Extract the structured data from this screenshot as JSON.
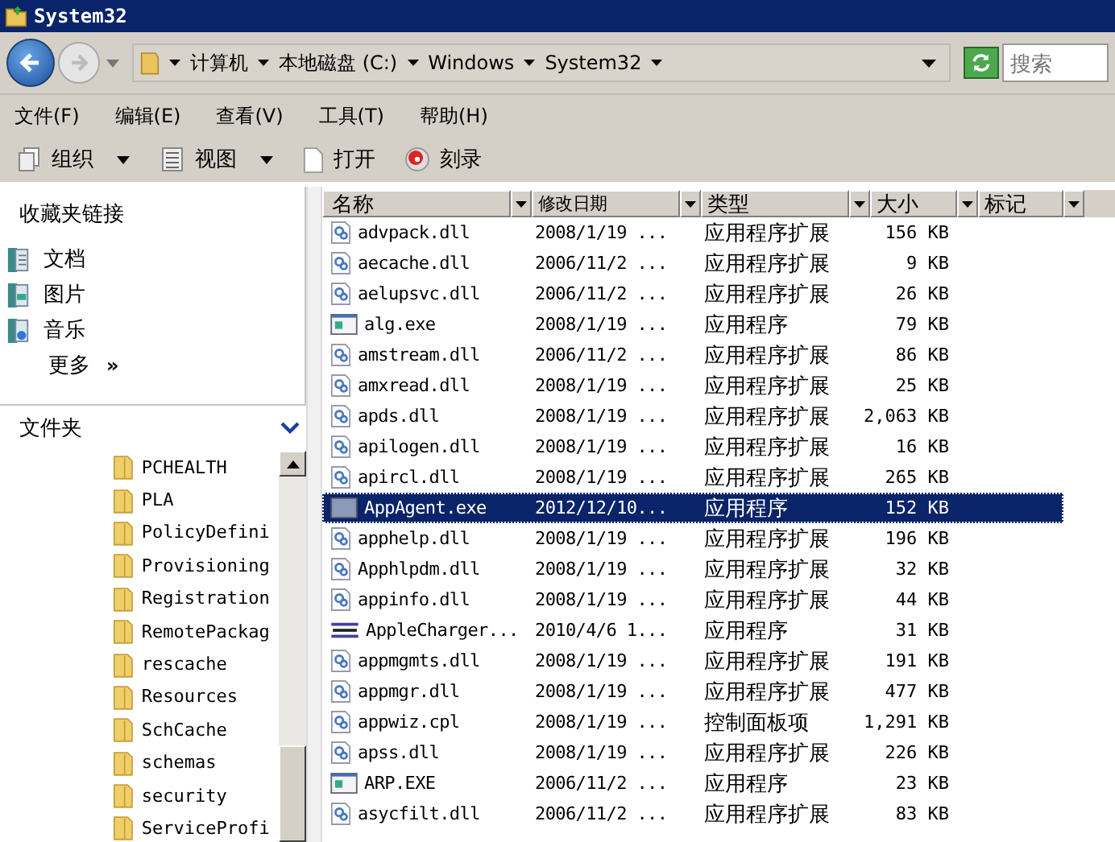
{
  "window": {
    "title": "System32"
  },
  "address": {
    "crumbs": [
      "计算机",
      "本地磁盘 (C:)",
      "Windows",
      "System32"
    ]
  },
  "search": {
    "placeholder": "搜索"
  },
  "menu": [
    "文件(F)",
    "编辑(E)",
    "查看(V)",
    "工具(T)",
    "帮助(H)"
  ],
  "toolbar": [
    {
      "kind": "organize",
      "label": "组织",
      "dropdown": true
    },
    {
      "kind": "views",
      "label": "视图",
      "dropdown": true
    },
    {
      "kind": "open",
      "label": "打开",
      "dropdown": false
    },
    {
      "kind": "burn",
      "label": "刻录",
      "dropdown": false
    }
  ],
  "favorites": {
    "title": "收藏夹链接",
    "items": [
      {
        "kind": "documents",
        "label": "文档"
      },
      {
        "kind": "pictures",
        "label": "图片"
      },
      {
        "kind": "music",
        "label": "音乐"
      }
    ],
    "more": "更多",
    "more_arrow": "»"
  },
  "folders": {
    "title": "文件夹",
    "items": [
      "PCHEALTH",
      "PLA",
      "PolicyDefini",
      "Provisioning",
      "Registration",
      "RemotePackag",
      "rescache",
      "Resources",
      "SchCache",
      "schemas",
      "security",
      "ServiceProfi"
    ]
  },
  "table": {
    "columns": [
      "名称",
      "修改日期",
      "类型",
      "大小",
      "标记"
    ],
    "rows": [
      {
        "kind": "dll",
        "name": "advpack.dll",
        "date": "2008/1/19 ...",
        "type": "应用程序扩展",
        "size": "156 KB",
        "selected": false
      },
      {
        "kind": "dll",
        "name": "aecache.dll",
        "date": "2006/11/2 ...",
        "type": "应用程序扩展",
        "size": "9 KB",
        "selected": false
      },
      {
        "kind": "dll",
        "name": "aelupsvc.dll",
        "date": "2006/11/2 ...",
        "type": "应用程序扩展",
        "size": "26 KB",
        "selected": false
      },
      {
        "kind": "exe",
        "name": "alg.exe",
        "date": "2008/1/19 ...",
        "type": "应用程序",
        "size": "79 KB",
        "selected": false
      },
      {
        "kind": "dll",
        "name": "amstream.dll",
        "date": "2006/11/2 ...",
        "type": "应用程序扩展",
        "size": "86 KB",
        "selected": false
      },
      {
        "kind": "dll",
        "name": "amxread.dll",
        "date": "2008/1/19 ...",
        "type": "应用程序扩展",
        "size": "25 KB",
        "selected": false
      },
      {
        "kind": "dll",
        "name": "apds.dll",
        "date": "2008/1/19 ...",
        "type": "应用程序扩展",
        "size": "2,063 KB",
        "selected": false
      },
      {
        "kind": "dll",
        "name": "apilogen.dll",
        "date": "2008/1/19 ...",
        "type": "应用程序扩展",
        "size": "16 KB",
        "selected": false
      },
      {
        "kind": "dll",
        "name": "apircl.dll",
        "date": "2008/1/19 ...",
        "type": "应用程序扩展",
        "size": "265 KB",
        "selected": false
      },
      {
        "kind": "app",
        "name": "AppAgent.exe",
        "date": "2012/12/10...",
        "type": "应用程序",
        "size": "152 KB",
        "selected": true
      },
      {
        "kind": "dll",
        "name": "apphelp.dll",
        "date": "2008/1/19 ...",
        "type": "应用程序扩展",
        "size": "196 KB",
        "selected": false
      },
      {
        "kind": "dll",
        "name": "Apphlpdm.dll",
        "date": "2008/1/19 ...",
        "type": "应用程序扩展",
        "size": "32 KB",
        "selected": false
      },
      {
        "kind": "dll",
        "name": "appinfo.dll",
        "date": "2008/1/19 ...",
        "type": "应用程序扩展",
        "size": "44 KB",
        "selected": false
      },
      {
        "kind": "banner",
        "name": "AppleCharger...",
        "date": "2010/4/6 1...",
        "type": "应用程序",
        "size": "31 KB",
        "selected": false
      },
      {
        "kind": "dll",
        "name": "appmgmts.dll",
        "date": "2008/1/19 ...",
        "type": "应用程序扩展",
        "size": "191 KB",
        "selected": false
      },
      {
        "kind": "dll",
        "name": "appmgr.dll",
        "date": "2008/1/19 ...",
        "type": "应用程序扩展",
        "size": "477 KB",
        "selected": false
      },
      {
        "kind": "dll",
        "name": "appwiz.cpl",
        "date": "2008/1/19 ...",
        "type": "控制面板项",
        "size": "1,291 KB",
        "selected": false
      },
      {
        "kind": "dll",
        "name": "apss.dll",
        "date": "2008/1/19 ...",
        "type": "应用程序扩展",
        "size": "226 KB",
        "selected": false
      },
      {
        "kind": "exe",
        "name": "ARP.EXE",
        "date": "2006/11/2 ...",
        "type": "应用程序",
        "size": "23 KB",
        "selected": false
      },
      {
        "kind": "dll",
        "name": "asycfilt.dll",
        "date": "2006/11/2 ...",
        "type": "应用程序扩展",
        "size": "83 KB",
        "selected": false
      }
    ]
  }
}
